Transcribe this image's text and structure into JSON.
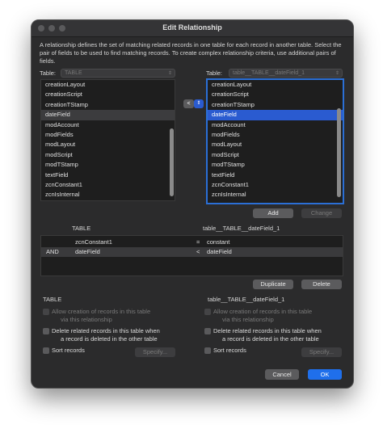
{
  "window": {
    "title": "Edit Relationship"
  },
  "description": "A relationship defines the set of matching related records in one table for each record in another table. Select the pair of fields to be used to find matching records. To create complex relationship criteria, use additional pairs of fields.",
  "left_table": {
    "label": "Table:",
    "popup_value": "TABLE",
    "fields": [
      "creationLayout",
      "creationScript",
      "creationTStamp",
      "dateField",
      "modAccount",
      "modFields",
      "modLayout",
      "modScript",
      "modTStamp",
      "textField",
      "zcnConstant1",
      "zcnIsInternal"
    ],
    "selected_index": 3
  },
  "operator": {
    "value": "<"
  },
  "right_table": {
    "label": "Table:",
    "popup_value": "table__TABLE__dateField_1",
    "fields": [
      "creationLayout",
      "creationScript",
      "creationTStamp",
      "dateField",
      "modAccount",
      "modFields",
      "modLayout",
      "modScript",
      "modTStamp",
      "textField",
      "zcnConstant1",
      "zcnIsInternal"
    ],
    "selected_index": 3
  },
  "buttons": {
    "add": "Add",
    "change": "Change",
    "duplicate": "Duplicate",
    "delete": "Delete",
    "cancel": "Cancel",
    "ok": "OK",
    "specify_left": "Specify...",
    "specify_right": "Specify..."
  },
  "criteria": {
    "header_left": "TABLE",
    "header_right": "table__TABLE__dateField_1",
    "rows": [
      {
        "conj": "",
        "left": "zcnConstant1",
        "op": "=",
        "right": "constant"
      },
      {
        "conj": "AND",
        "left": "dateField",
        "op": "<",
        "right": "dateField"
      }
    ]
  },
  "options_left": {
    "title": "TABLE",
    "allow_creation_1": "Allow creation of records in this table",
    "allow_creation_2": "via this relationship",
    "delete_1": "Delete related records in this table when",
    "delete_2": "a record is deleted in the other table",
    "sort": "Sort records"
  },
  "options_right": {
    "title": "table__TABLE__dateField_1",
    "allow_creation_1": "Allow creation of records in this table",
    "allow_creation_2": "via this relationship",
    "delete_1": "Delete related records in this table when",
    "delete_2": "a record is deleted in the other table",
    "sort": "Sort records"
  }
}
